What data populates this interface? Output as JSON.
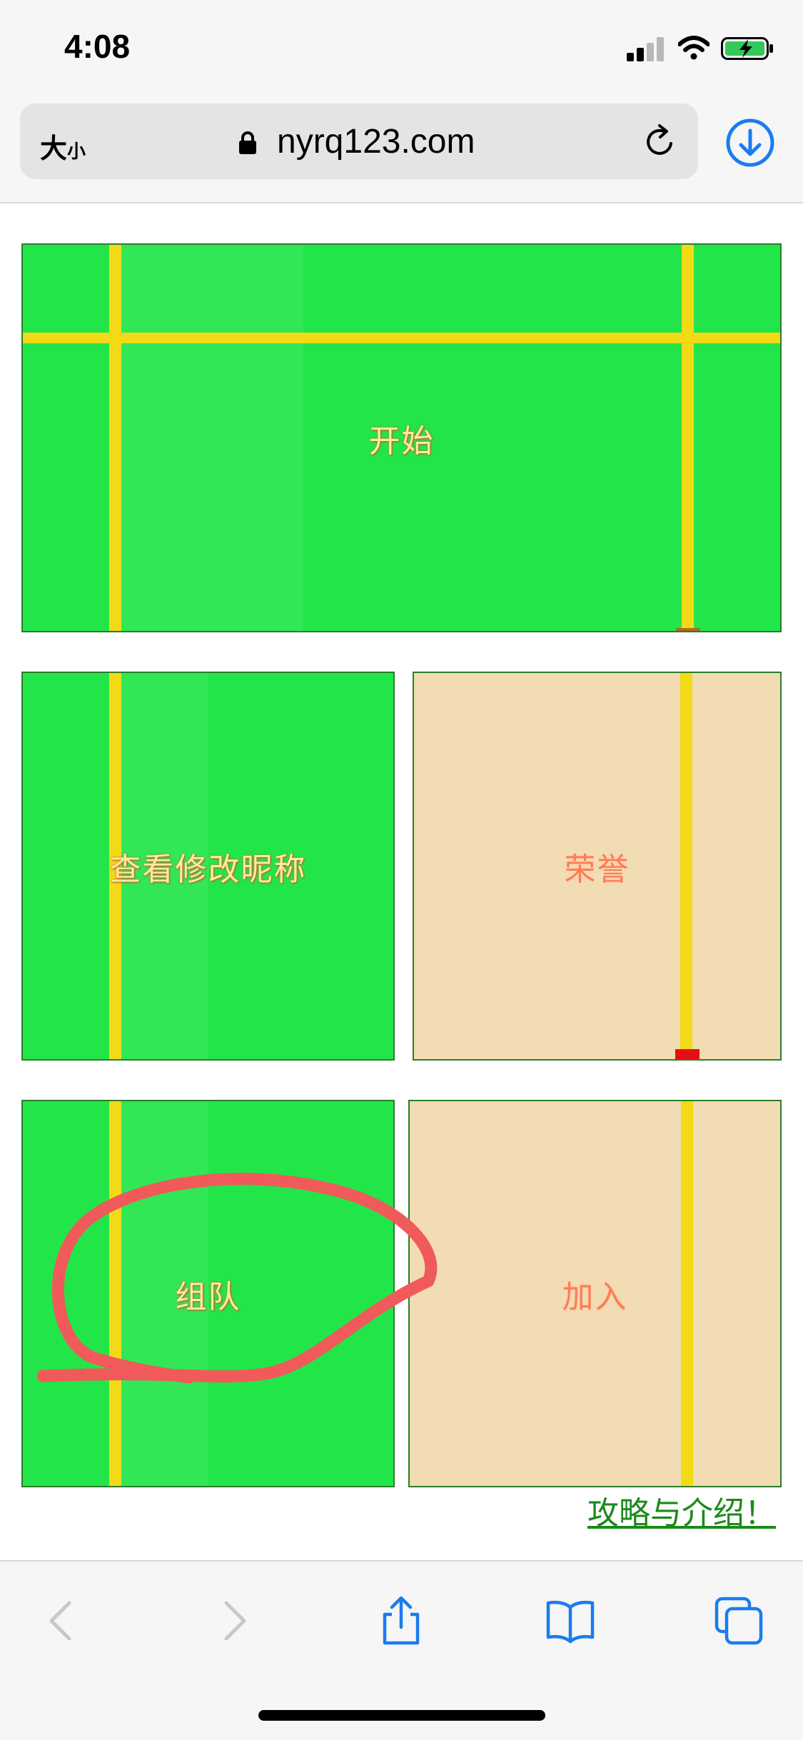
{
  "status": {
    "time": "4:08"
  },
  "browser": {
    "text_size_label": "大",
    "text_size_small": "小",
    "domain": "nyrq123.com"
  },
  "menu": {
    "start": "开始",
    "nickname": "查看修改昵称",
    "honor": "荣誉",
    "team": "组队",
    "join": "加入",
    "guide": "攻略与介绍！"
  },
  "colors": {
    "green_tile": "#22e649",
    "tan_tile": "#f2dcb4",
    "yellow_line": "#f2da16",
    "annotation": "#f05a5a",
    "ios_blue": "#1a7cf0"
  },
  "icons": [
    "lock-icon",
    "reload-icon",
    "download-icon",
    "back-icon",
    "forward-icon",
    "share-icon",
    "bookmarks-icon",
    "tabs-icon"
  ]
}
